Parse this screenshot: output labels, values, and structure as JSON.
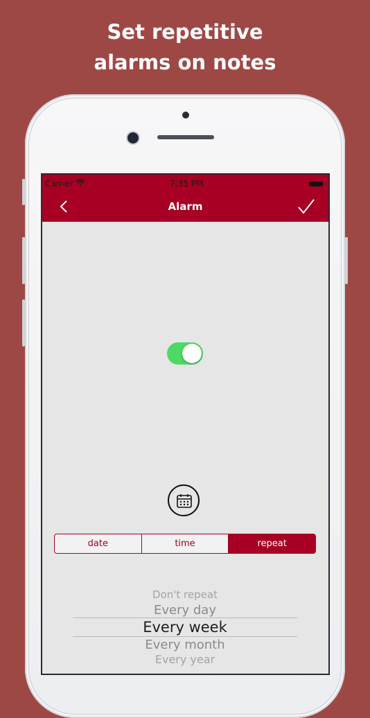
{
  "headline": [
    "Set repetitive",
    "alarms on notes"
  ],
  "status_bar": {
    "carrier": "Carrier",
    "time": "7:35 PM"
  },
  "nav": {
    "title": "Alarm",
    "back_icon": "chevron-left-icon",
    "confirm_icon": "checkmark-icon"
  },
  "alarm_toggle": {
    "on": true
  },
  "calendar_button": {
    "icon": "calendar-icon"
  },
  "segments": [
    {
      "label": "date",
      "selected": false
    },
    {
      "label": "time",
      "selected": false
    },
    {
      "label": "repeat",
      "selected": true
    }
  ],
  "picker": {
    "options": [
      "Don't repeat",
      "Every day",
      "Every week",
      "Every month",
      "Every year"
    ],
    "selected": "Every week"
  },
  "colors": {
    "background": "#9e4845",
    "accent": "#a70024",
    "toggle_on": "#4cd964",
    "screen_bg": "#e6e6e6"
  }
}
